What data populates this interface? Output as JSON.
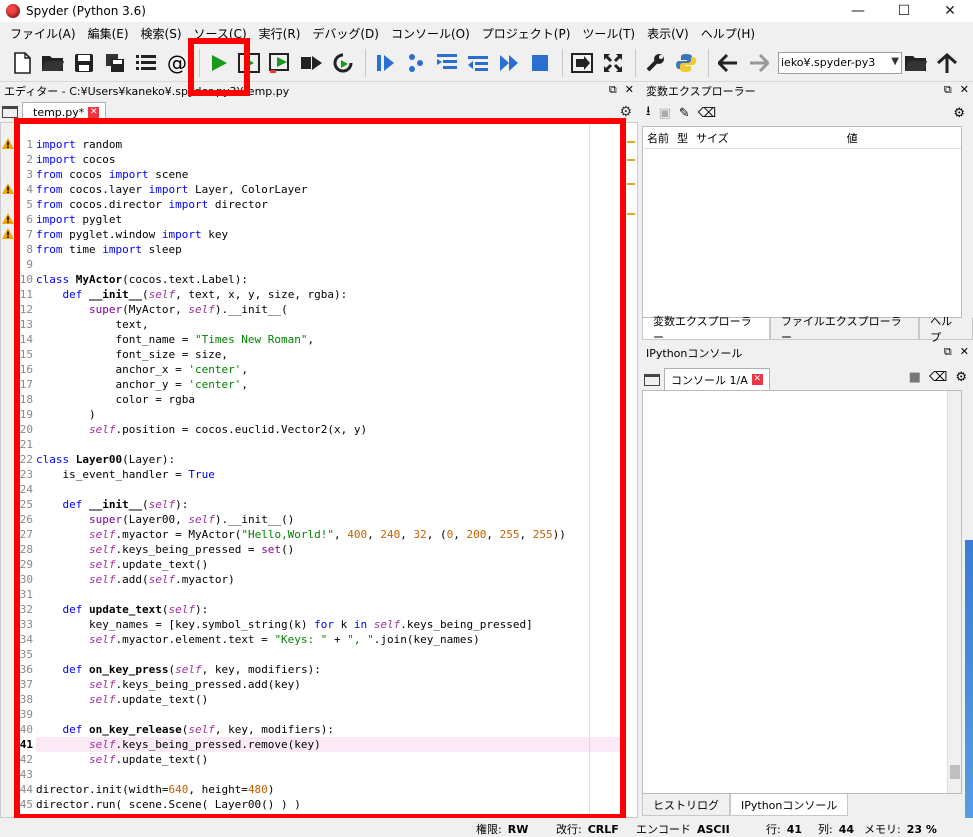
{
  "window": {
    "title": "Spyder (Python 3.6)",
    "controls": [
      "—",
      "☐",
      "✕"
    ]
  },
  "menu": [
    "ファイル(A)",
    "編集(E)",
    "検索(S)",
    "ソース(C)",
    "実行(R)",
    "デバッグ(D)",
    "コンソール(O)",
    "プロジェクト(P)",
    "ツール(T)",
    "表示(V)",
    "ヘルプ(H)"
  ],
  "toolbar": {
    "path_value": "ieko¥.spyder-py3",
    "icons": [
      "new-file-icon",
      "open-folder-icon",
      "save-icon",
      "save-all-icon",
      "list-icon",
      "at-icon",
      "run-icon",
      "run-cell-icon",
      "run-cell-advance-icon",
      "run-selection-icon",
      "rerun-icon",
      "debug-icon",
      "step-icon",
      "step-into-icon",
      "step-return-icon",
      "continue-icon",
      "stop-icon",
      "maximize-pane-icon",
      "fullscreen-icon",
      "wrench-icon",
      "python-icon",
      "back-arrow-icon",
      "forward-arrow-icon",
      "browse-folder-icon",
      "up-arrow-icon"
    ]
  },
  "editor": {
    "header": "エディター - C:¥Users¥kaneko¥.spyder-py3¥temp.py",
    "tab_label": "temp.py*",
    "warning_lines": [
      1,
      4,
      6,
      7
    ]
  },
  "code_lines": [
    "import random",
    "import cocos",
    "from cocos import scene",
    "from cocos.layer import Layer, ColorLayer",
    "from cocos.director import director",
    "import pyglet",
    "from pyglet.window import key",
    "from time import sleep",
    "",
    "class MyActor(cocos.text.Label):",
    "    def __init__(self, text, x, y, size, rgba):",
    "        super(MyActor, self).__init__(",
    "            text,",
    "            font_name = \"Times New Roman\",",
    "            font_size = size,",
    "            anchor_x = 'center',",
    "            anchor_y = 'center',",
    "            color = rgba",
    "        )",
    "        self.position = cocos.euclid.Vector2(x, y)",
    "",
    "class Layer00(Layer):",
    "    is_event_handler = True",
    "",
    "    def __init__(self):",
    "        super(Layer00, self).__init__()",
    "        self.myactor = MyActor(\"Hello,World!\", 400, 240, 32, (0, 200, 255, 255))",
    "        self.keys_being_pressed = set()",
    "        self.update_text()",
    "        self.add(self.myactor)",
    "",
    "    def update_text(self):",
    "        key_names = [key.symbol_string(k) for k in self.keys_being_pressed]",
    "        self.myactor.element.text = \"Keys: \" + \", \".join(key_names)",
    "",
    "    def on_key_press(self, key, modifiers):",
    "        self.keys_being_pressed.add(key)",
    "        self.update_text()",
    "",
    "    def on_key_release(self, key, modifiers):",
    "        self.keys_being_pressed.remove(key)",
    "        self.update_text()",
    "",
    "director.init(width=640, height=480)",
    "director.run( scene.Scene( Layer00() ) )"
  ],
  "current_line": 41,
  "variable_explorer": {
    "header": "変数エクスプローラー",
    "columns": [
      "名前",
      "型",
      "サイズ",
      "値"
    ],
    "tabs": [
      "変数エクスプローラー",
      "ファイルエクスプローラー",
      "ヘルプ"
    ]
  },
  "ipython": {
    "header": "IPythonコンソール",
    "tab_label": "コンソール 1/A",
    "bottom_tabs": [
      "ヒストリログ",
      "IPythonコンソール"
    ]
  },
  "statusbar": {
    "permissions_label": "権限:",
    "permissions_value": "RW",
    "eol_label": "改行:",
    "eol_value": "CRLF",
    "encoding_label": "エンコード",
    "encoding_value": "ASCII",
    "line_label": "行:",
    "line_value": "41",
    "col_label": "列:",
    "col_value": "44",
    "memory_label": "メモリ:",
    "memory_value": "23 %"
  },
  "colors": {
    "highlight_box": "#ff0000",
    "run_green": "#1a9a1a",
    "toolbar_blue": "#2a6fd0"
  }
}
